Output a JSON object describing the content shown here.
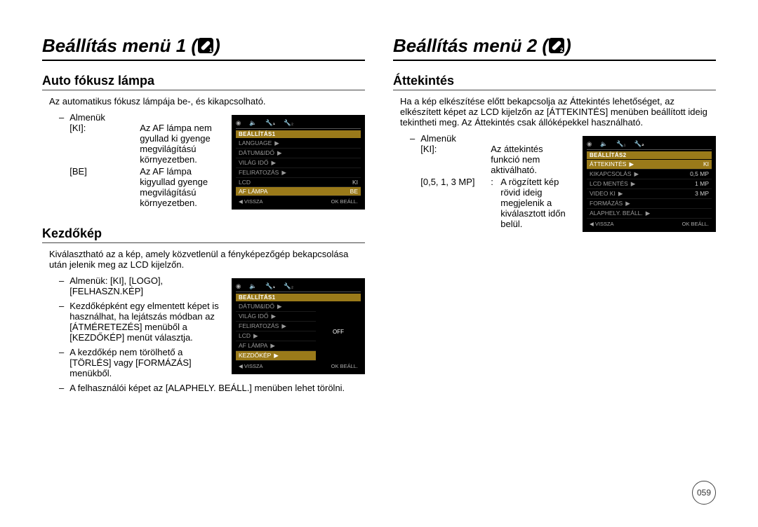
{
  "page_number": "059",
  "col1": {
    "title": "Beállítás menü 1 (",
    "title_close": ")",
    "section1": {
      "heading": "Auto fókusz lámpa",
      "intro": "Az automatikus fókusz lámpája be-, és kikapcsolható.",
      "almenuk": "Almenük",
      "rows": [
        {
          "key": "[KI]:",
          "val": "Az AF lámpa nem gyullad ki gyenge megvilágítású környezetben."
        },
        {
          "key": "[BE]",
          "val": "Az AF lámpa kigyullad gyenge megvilágítású környezetben."
        }
      ],
      "lcd": {
        "header": "BEÁLLÍTÁS1",
        "rows": [
          {
            "label": "LANGUAGE",
            "chev": "▶",
            "value": ""
          },
          {
            "label": "DÁTUM&IDŐ",
            "chev": "▶",
            "value": ""
          },
          {
            "label": "VILÁG IDŐ",
            "chev": "▶",
            "value": ""
          },
          {
            "label": "FELIRATOZÁS",
            "chev": "▶",
            "value": ""
          },
          {
            "label": "LCD",
            "chev": "",
            "value": "KI"
          },
          {
            "label": "AF LÁMPA",
            "chev": "",
            "value": "BE",
            "highlight": true
          }
        ],
        "footer_left": "◀  VISSZA",
        "footer_right": "OK  BEÁLL."
      }
    },
    "section2": {
      "heading": "Kezdőkép",
      "intro": "Kiválasztható az a kép, amely közvetlenül a fényképezőgép bekapcsolása után jelenik meg az LCD kijelzőn.",
      "bullets": [
        "Almenük: [KI], [LOGO], [FELHASZN.KÉP]",
        "Kezdőképként egy elmentett képet is használhat, ha lejátszás módban az [ÁTMÉRETEZÉS] menüből a [KEZDŐKÉP] menüt választja.",
        "A kezdőkép nem törölhető a [TÖRLÉS] vagy [FORMÁZÁS] menükből.",
        "A felhasználói képet az [ALAPHELY. BEÁLL.] menüben lehet törölni."
      ],
      "lcd": {
        "header": "BEÁLLÍTÁS1",
        "rows": [
          {
            "label": "DÁTUM&IDŐ",
            "chev": "▶"
          },
          {
            "label": "VILÁG IDŐ",
            "chev": "▶"
          },
          {
            "label": "FELIRATOZÁS",
            "chev": "▶"
          },
          {
            "label": "LCD",
            "chev": "▶"
          },
          {
            "label": "AF LÁMPA",
            "chev": "▶"
          },
          {
            "label": "KEZDŐKÉP",
            "chev": "▶",
            "highlight": true
          }
        ],
        "preview": "OFF",
        "footer_left": "◀  VISSZA",
        "footer_right": "OK  BEÁLL."
      }
    }
  },
  "col2": {
    "title": "Beállítás menü 2 (",
    "title_close": ")",
    "section1": {
      "heading": "Áttekintés",
      "intro": "Ha a kép elkészítése előtt bekapcsolja az Áttekintés lehetőséget, az elkészített képet az LCD kijelzőn az [ÁTTEKINTÉS] menüben beállított ideig tekintheti meg. Az Áttekintés csak állóképekkel használható.",
      "almenuk": "Almenük",
      "rows": [
        {
          "key": "[KI]:",
          "val": "Az áttekintés funkció nem aktiválható."
        },
        {
          "key": "[0,5, 1, 3 MP]",
          "colon": ":",
          "val": "A rögzített kép rövid ideig megjelenik a kiválasztott időn belül."
        }
      ],
      "lcd": {
        "header": "BEÁLLÍTÁS2",
        "rows": [
          {
            "label": "ÁTTEKINTÉS",
            "chev": "▶",
            "value": "KI",
            "highlight": true
          },
          {
            "label": "KIKAPCSOLÁS",
            "chev": "▶",
            "value": "0,5 MP"
          },
          {
            "label": "LCD MENTÉS",
            "chev": "▶",
            "value": "1 MP"
          },
          {
            "label": "VIDEO KI",
            "chev": "▶",
            "value": "3 MP"
          },
          {
            "label": "FORMÁZÁS",
            "chev": "▶",
            "value": ""
          },
          {
            "label": "ALAPHELY. BEÁLL.",
            "chev": "▶",
            "value": ""
          }
        ],
        "footer_left": "◀  VISSZA",
        "footer_right": "OK  BEÁLL."
      }
    }
  },
  "icons": {
    "camera": "📷",
    "speaker": "🔈",
    "wrench1": "🔧",
    "wrench2": "🔧"
  }
}
